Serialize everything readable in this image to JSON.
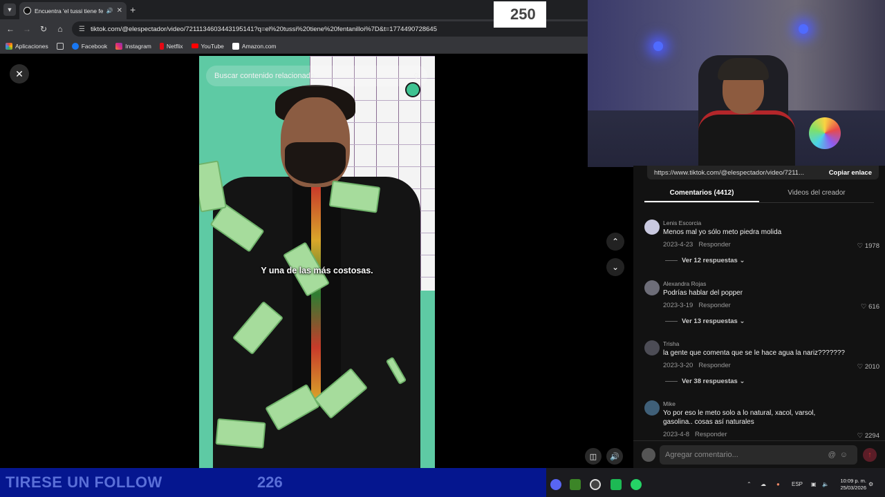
{
  "browser": {
    "tab_title": "Encuentra 'el tussi tiene fen",
    "new_tab": "+",
    "url": "tiktok.com/@elespectador/video/7211134603443195141?q=el%20tussi%20tiene%20fentanilloi%7D&t=1774490728645",
    "bookmarks": [
      "Aplicaciones",
      "Facebook",
      "Instagram",
      "Netflix",
      "YouTube",
      "Amazon.com"
    ]
  },
  "video": {
    "search_placeholder": "Buscar contenido relacionado",
    "subtitle": "Y una de las más costosas."
  },
  "share": {
    "link": "https://www.tiktok.com/@elespectador/video/7211...",
    "copy_label": "Copiar enlace"
  },
  "tabs": {
    "comments": "Comentarios (4412)",
    "creator_videos": "Videos del creador"
  },
  "comments": [
    {
      "user": "Lenis Escorcia",
      "text": "Menos mal yo sólo meto piedra molida",
      "date": "2023-4-23",
      "reply": "Responder",
      "likes": "1978",
      "replies": "Ver 12 respuestas"
    },
    {
      "user": "Alexandra Rojas",
      "text": "Podrías hablar del popper",
      "date": "2023-3-19",
      "reply": "Responder",
      "likes": "616",
      "replies": "Ver 13 respuestas"
    },
    {
      "user": "Trisha",
      "text": "la gente que comenta que se le hace agua la nariz???????",
      "date": "2023-3-20",
      "reply": "Responder",
      "likes": "2010",
      "replies": "Ver 38 respuestas"
    },
    {
      "user": "Mike",
      "text": "Yo por eso le meto solo a lo natural, xacol, varsol, gasolina.. cosas así naturales",
      "date": "2023-4-8",
      "reply": "Responder",
      "likes": "2294",
      "replies": ""
    }
  ],
  "composer": {
    "placeholder": "Agregar comentario..."
  },
  "stream": {
    "follow_text": "TIRESE UN FOLLOW",
    "follow_count": "226",
    "goal": "250"
  },
  "taskbar": {
    "lang": "ESP",
    "time": "10:09 p. m.",
    "date": "25/03/2026"
  },
  "icons": {
    "close": "close-icon",
    "up": "chevron-up-icon",
    "down": "chevron-down-icon",
    "heart": "heart-icon",
    "mention": "at-icon",
    "emoji": "emoji-icon",
    "send": "send-icon"
  },
  "colors": {
    "tiktok_bg": "#121212",
    "video_teal": "#5ecaa4",
    "stream_blue": "#05168f",
    "send_red": "#5b1d27"
  }
}
